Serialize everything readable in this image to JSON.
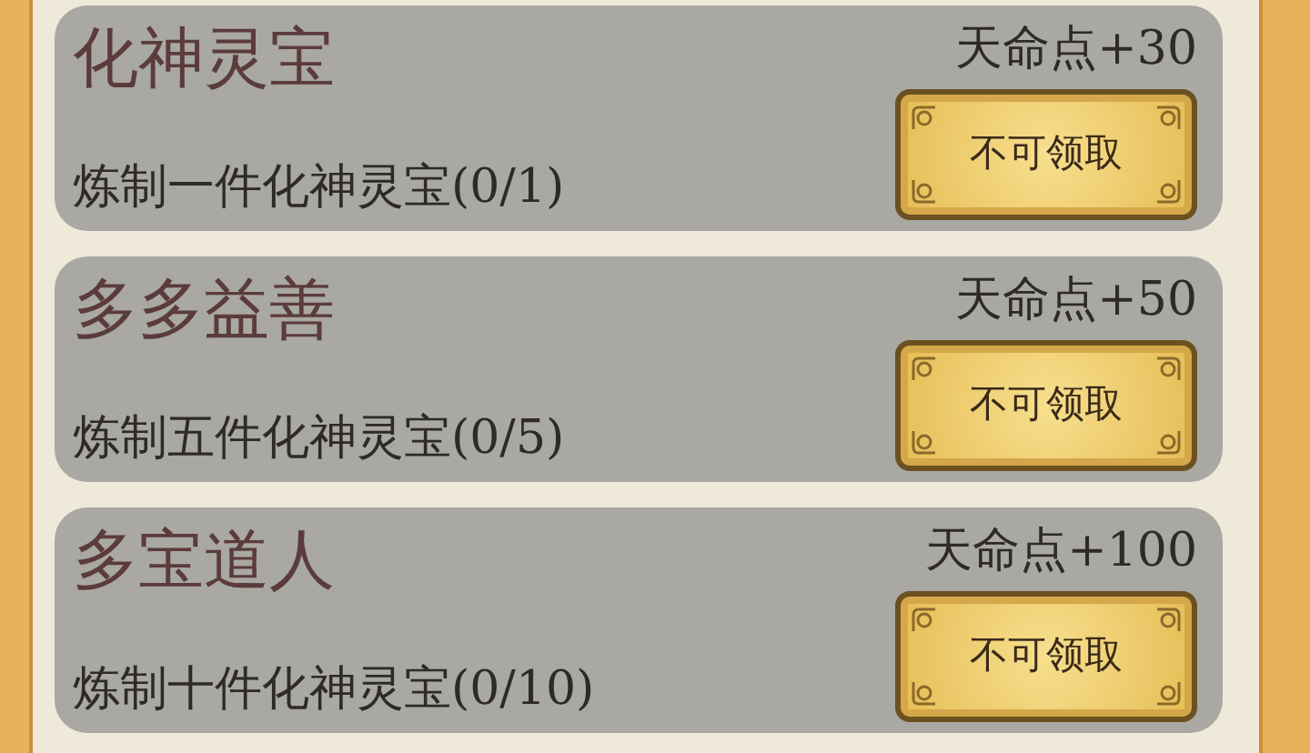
{
  "tasks": [
    {
      "title": "化神灵宝",
      "reward": "天命点+30",
      "description": "炼制一件化神灵宝(0/1)",
      "button": "不可领取"
    },
    {
      "title": "多多益善",
      "reward": "天命点+50",
      "description": "炼制五件化神灵宝(0/5)",
      "button": "不可领取"
    },
    {
      "title": "多宝道人",
      "reward": "天命点+100",
      "description": "炼制十件化神灵宝(0/10)",
      "button": "不可领取"
    }
  ]
}
